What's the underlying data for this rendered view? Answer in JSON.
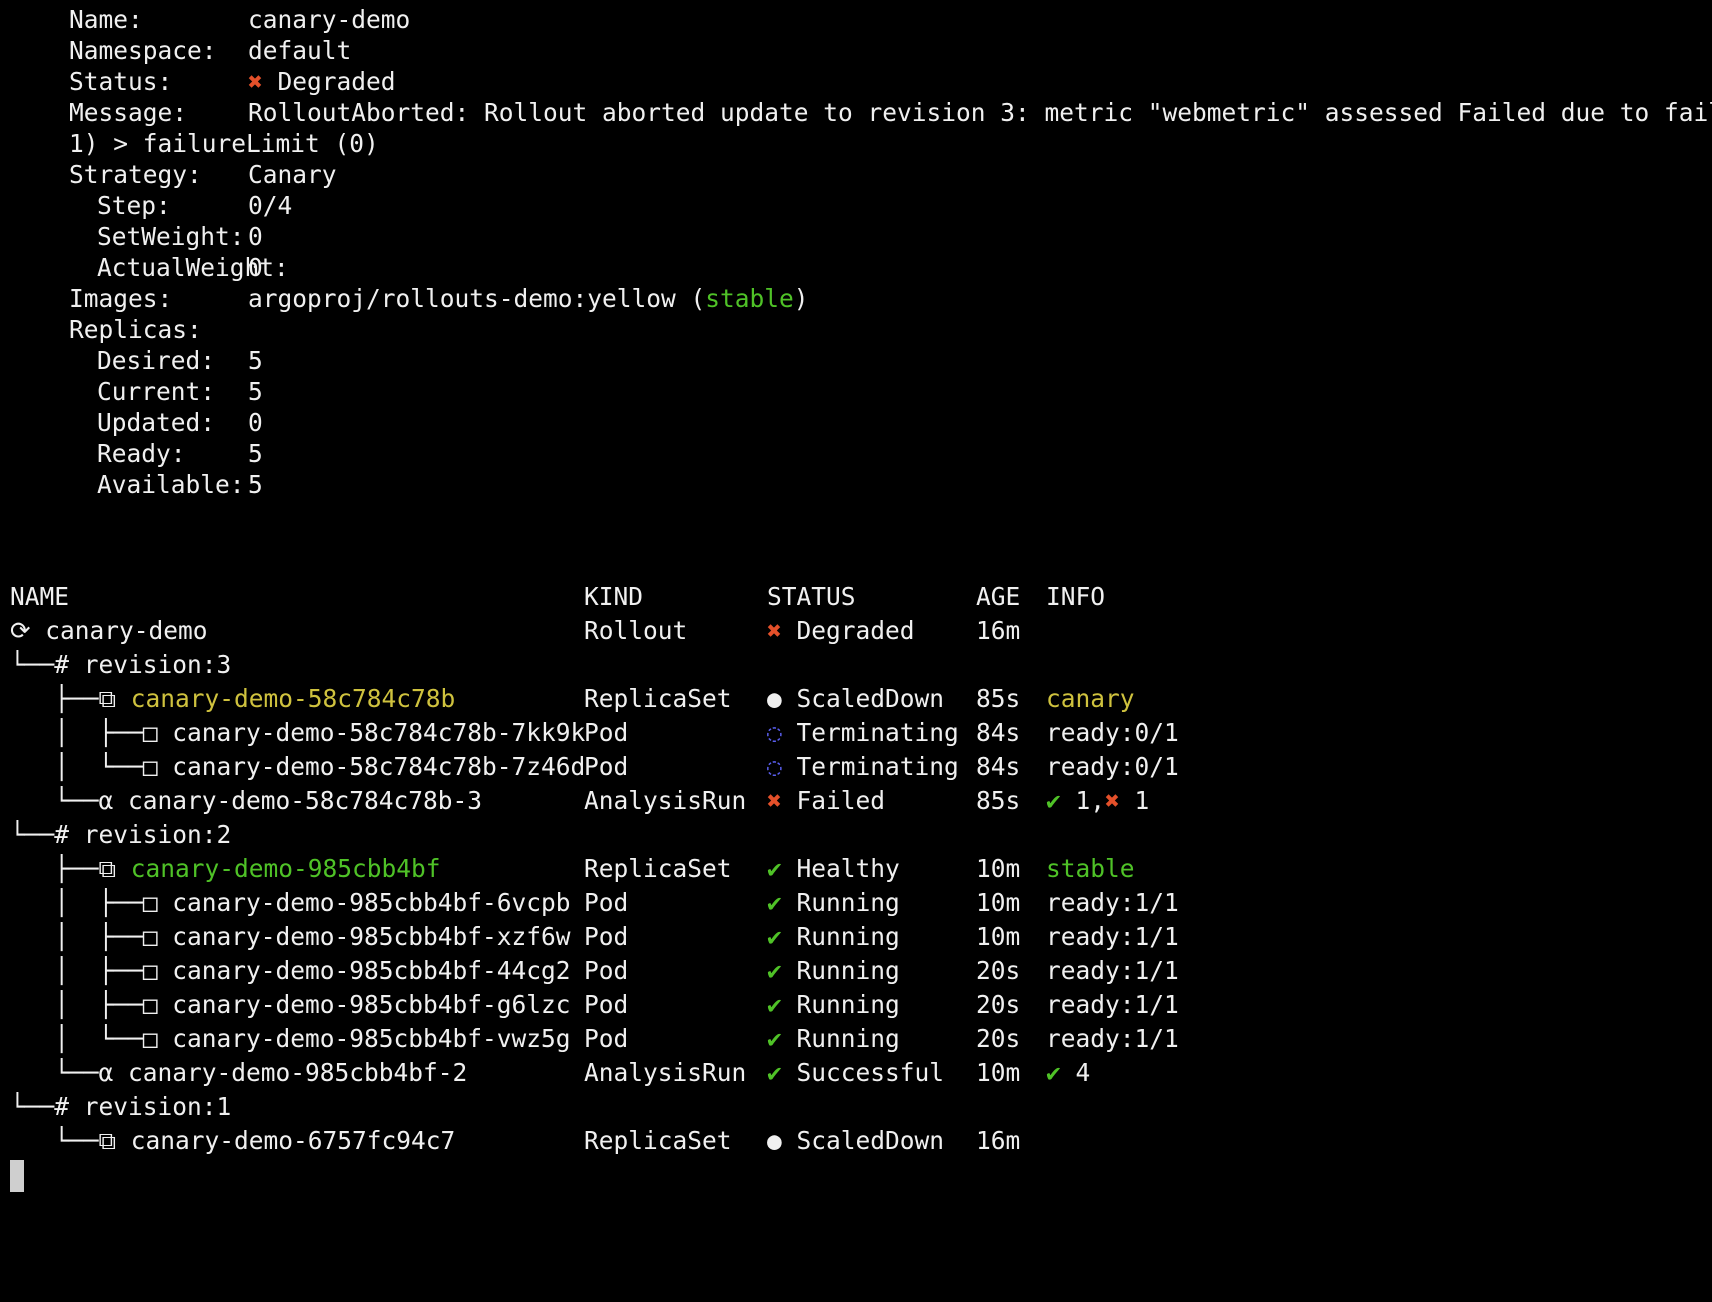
{
  "summary": {
    "name": {
      "label": "Name:",
      "value": "canary-demo"
    },
    "namespace": {
      "label": "Namespace:",
      "value": "default"
    },
    "status": {
      "label": "Status:",
      "icon": "✖",
      "value": "Degraded"
    },
    "message": {
      "label": "Message:",
      "line1": "RolloutAborted: Rollout aborted update to revision 3: metric \"webmetric\" assessed Failed due to failed (",
      "line2": "1) > failureLimit (0)"
    },
    "strategy": {
      "label": "Strategy:",
      "value": "Canary"
    },
    "step": {
      "label": "Step:",
      "value": "0/4"
    },
    "set_weight": {
      "label": "SetWeight:",
      "value": "0"
    },
    "actual_weight": {
      "label": "ActualWeight:",
      "value": "0"
    },
    "images": {
      "label": "Images:",
      "value": "argoproj/rollouts-demo:yellow (",
      "tag": "stable",
      "close": ")"
    },
    "replicas": {
      "label": "Replicas:"
    },
    "desired": {
      "label": "Desired:",
      "value": "5"
    },
    "current": {
      "label": "Current:",
      "value": "5"
    },
    "updated": {
      "label": "Updated:",
      "value": "0"
    },
    "ready": {
      "label": "Ready:",
      "value": "5"
    },
    "available": {
      "label": "Available:",
      "value": "5"
    }
  },
  "table": {
    "headers": {
      "name": "NAME",
      "kind": "KIND",
      "status": "STATUS",
      "age": "AGE",
      "info": "INFO"
    },
    "rows": [
      {
        "prefix": "⟳ ",
        "name": "canary-demo",
        "kind": "Rollout",
        "status_icon": "✖",
        "status": "Degraded",
        "age": "16m",
        "info": ""
      },
      {
        "prefix": "└──# ",
        "name": "revision:3",
        "kind": "",
        "status_icon": "",
        "status": "",
        "age": "",
        "info": ""
      },
      {
        "prefix": "   ├──⧉ ",
        "name": "canary-demo-58c784c78b",
        "kind": "ReplicaSet",
        "status_icon": "●",
        "status": "ScaledDown",
        "age": "85s",
        "info": "canary"
      },
      {
        "prefix": "   │  ├──□ ",
        "name": "canary-demo-58c784c78b-7kk9k",
        "kind": "Pod",
        "status_icon": "◌",
        "status": "Terminating",
        "age": "84s",
        "info": "ready:0/1"
      },
      {
        "prefix": "   │  └──□ ",
        "name": "canary-demo-58c784c78b-7z46d",
        "kind": "Pod",
        "status_icon": "◌",
        "status": "Terminating",
        "age": "84s",
        "info": "ready:0/1"
      },
      {
        "prefix": "   └──α ",
        "name": "canary-demo-58c784c78b-3",
        "kind": "AnalysisRun",
        "status_icon": "✖",
        "status": "Failed",
        "age": "85s",
        "info_check": "✔",
        "info_a": " 1,",
        "info_x": "✖",
        "info_b": " 1"
      },
      {
        "prefix": "└──# ",
        "name": "revision:2",
        "kind": "",
        "status_icon": "",
        "status": "",
        "age": "",
        "info": ""
      },
      {
        "prefix": "   ├──⧉ ",
        "name": "canary-demo-985cbb4bf",
        "kind": "ReplicaSet",
        "status_icon": "✔",
        "status": "Healthy",
        "age": "10m",
        "info": "stable"
      },
      {
        "prefix": "   │  ├──□ ",
        "name": "canary-demo-985cbb4bf-6vcpb",
        "kind": "Pod",
        "status_icon": "✔",
        "status": "Running",
        "age": "10m",
        "info": "ready:1/1"
      },
      {
        "prefix": "   │  ├──□ ",
        "name": "canary-demo-985cbb4bf-xzf6w",
        "kind": "Pod",
        "status_icon": "✔",
        "status": "Running",
        "age": "10m",
        "info": "ready:1/1"
      },
      {
        "prefix": "   │  ├──□ ",
        "name": "canary-demo-985cbb4bf-44cg2",
        "kind": "Pod",
        "status_icon": "✔",
        "status": "Running",
        "age": "20s",
        "info": "ready:1/1"
      },
      {
        "prefix": "   │  ├──□ ",
        "name": "canary-demo-985cbb4bf-g6lzc",
        "kind": "Pod",
        "status_icon": "✔",
        "status": "Running",
        "age": "20s",
        "info": "ready:1/1"
      },
      {
        "prefix": "   │  └──□ ",
        "name": "canary-demo-985cbb4bf-vwz5g",
        "kind": "Pod",
        "status_icon": "✔",
        "status": "Running",
        "age": "20s",
        "info": "ready:1/1"
      },
      {
        "prefix": "   └──α ",
        "name": "canary-demo-985cbb4bf-2",
        "kind": "AnalysisRun",
        "status_icon": "✔",
        "status": "Successful",
        "age": "10m",
        "info_check": "✔",
        "info_a": " 4"
      },
      {
        "prefix": "└──# ",
        "name": "revision:1",
        "kind": "",
        "status_icon": "",
        "status": "",
        "age": "",
        "info": ""
      },
      {
        "prefix": "   └──⧉ ",
        "name": "canary-demo-6757fc94c7",
        "kind": "ReplicaSet",
        "status_icon": "●",
        "status": "ScaledDown",
        "age": "16m",
        "info": ""
      }
    ]
  },
  "colors": {
    "background": "#000000",
    "text": "#f0f0f0",
    "green": "#4fc227",
    "red": "#e4502a",
    "yellow": "#cfc23e",
    "blue": "#5a5ff0"
  }
}
